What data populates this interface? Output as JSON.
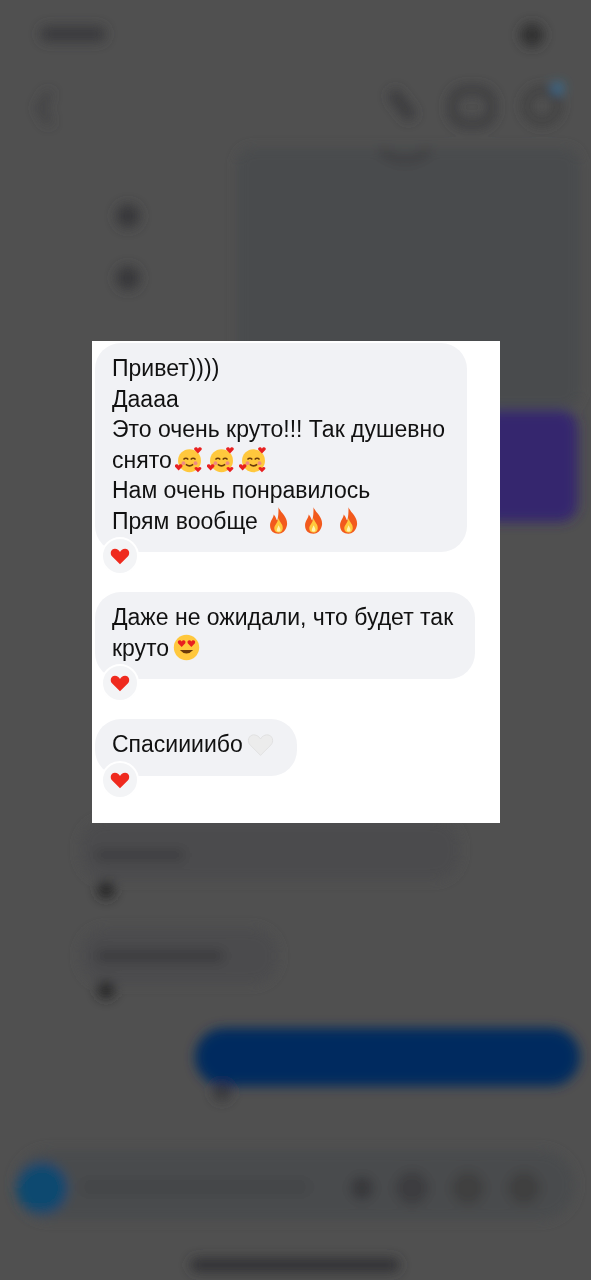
{
  "messages": [
    {
      "lines": [
        [
          {
            "kind": "text",
            "text": "Привет))))"
          }
        ],
        [
          {
            "kind": "text",
            "text": "Даааа"
          }
        ],
        [
          {
            "kind": "text",
            "text": "Это очень круто!!! Так душевно"
          }
        ],
        [
          {
            "kind": "text",
            "text": "снято"
          },
          {
            "kind": "blush"
          },
          {
            "kind": "blush"
          },
          {
            "kind": "blush"
          }
        ],
        [
          {
            "kind": "text",
            "text": "Нам очень понравилось"
          }
        ],
        [
          {
            "kind": "text",
            "text": "Прям вообще"
          },
          {
            "kind": "fire"
          },
          {
            "kind": "fire"
          },
          {
            "kind": "fire"
          }
        ]
      ],
      "reacted": true
    },
    {
      "lines": [
        [
          {
            "kind": "text",
            "text": "Даже не ожидали, что будет так"
          }
        ],
        [
          {
            "kind": "text",
            "text": "круто"
          },
          {
            "kind": "hearteyes"
          }
        ]
      ],
      "reacted": true
    },
    {
      "lines": [
        [
          {
            "kind": "text",
            "text": "Спасиииибо"
          },
          {
            "kind": "whiteheart"
          }
        ]
      ],
      "reacted": true
    }
  ]
}
